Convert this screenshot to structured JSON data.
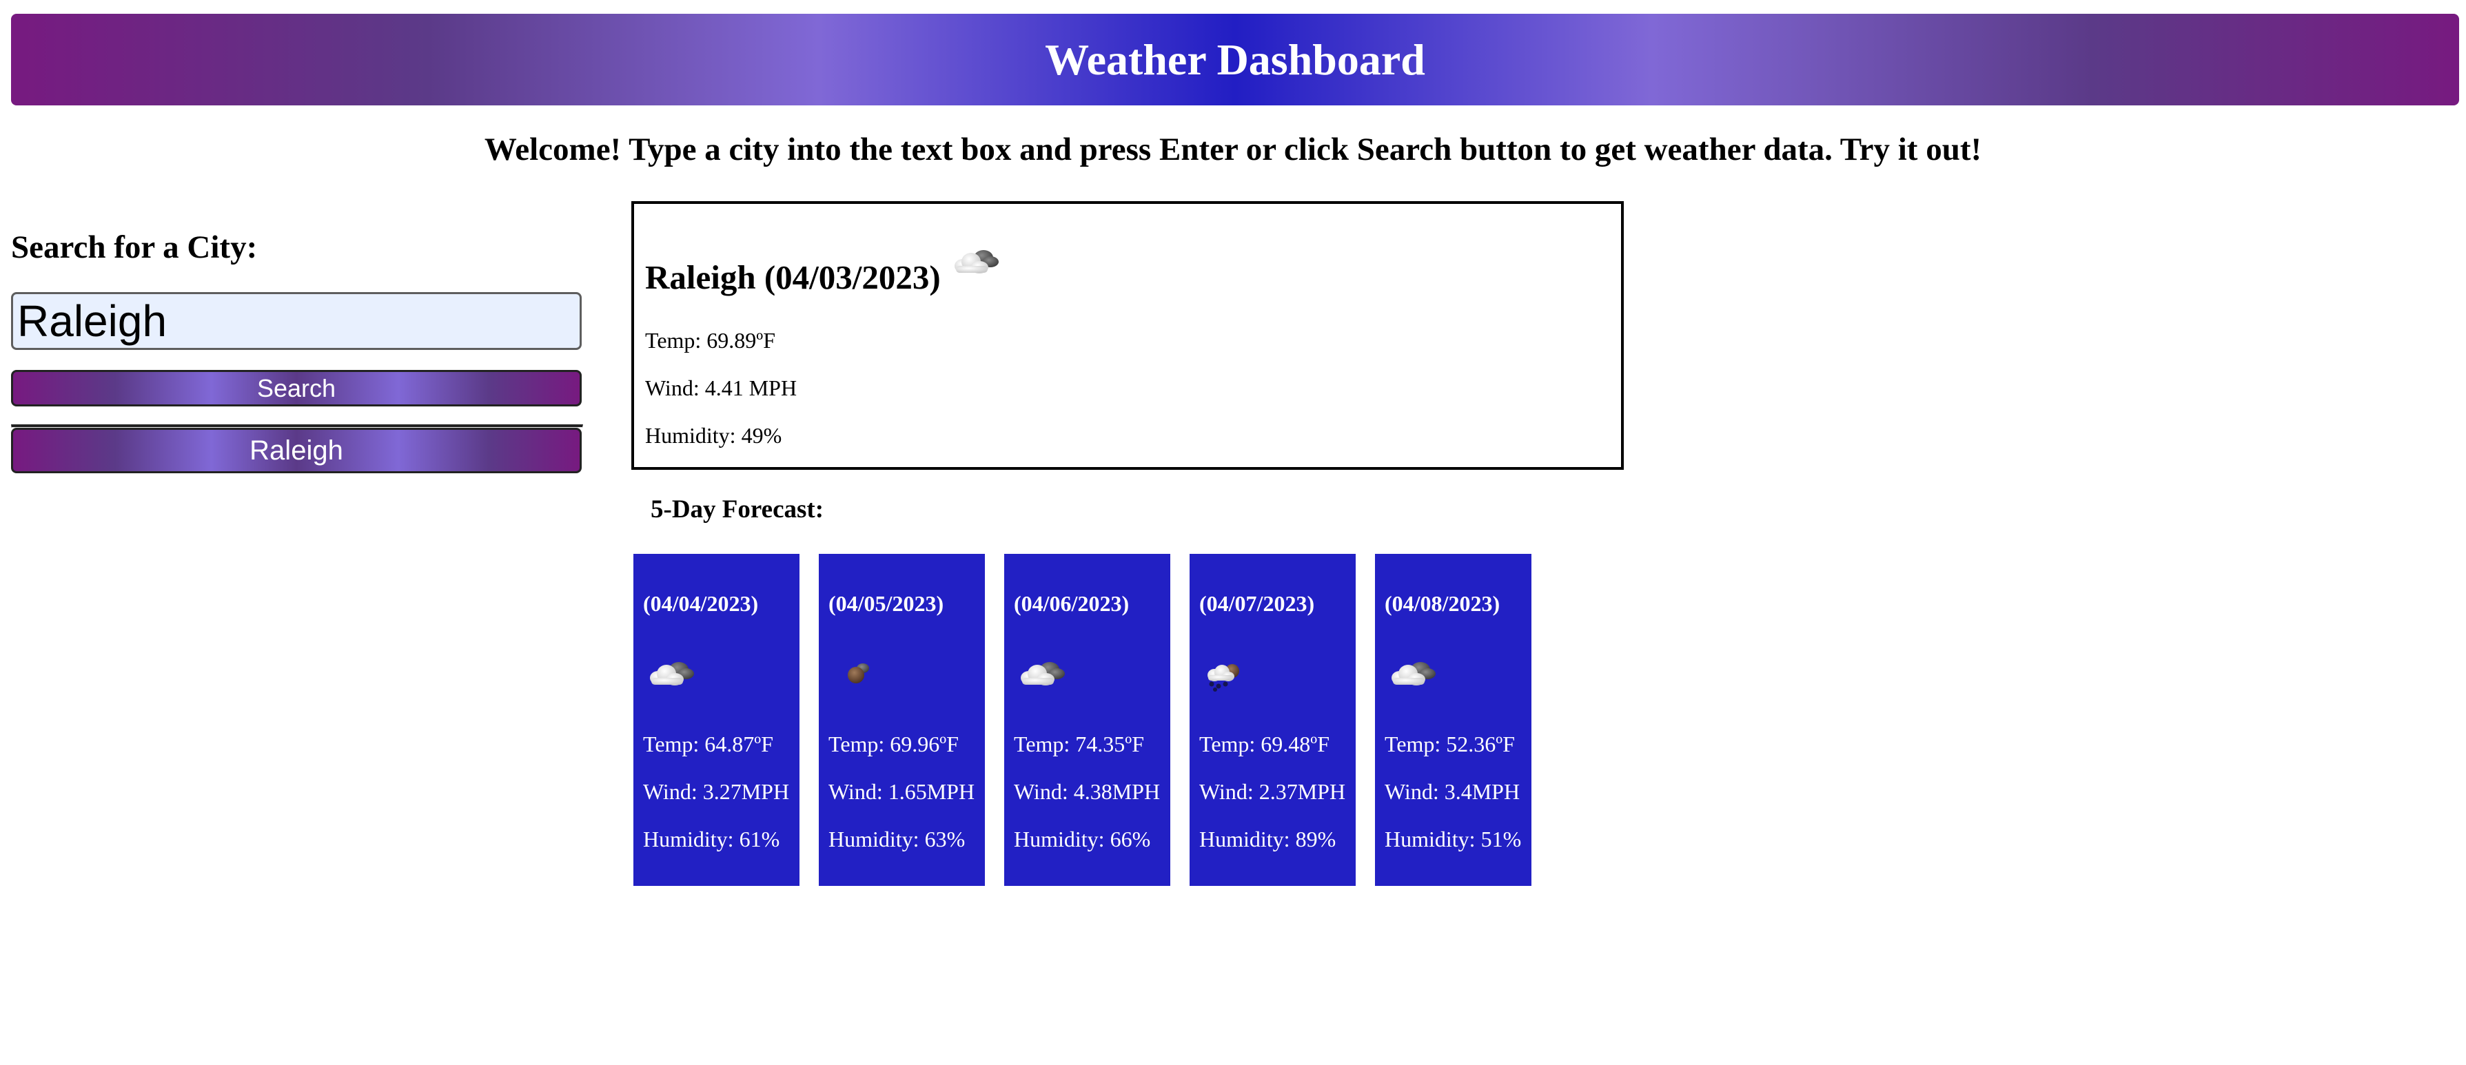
{
  "header": {
    "title": "Weather Dashboard"
  },
  "welcome": "Welcome! Type a city into the text box and press Enter or click Search button to get weather data. Try it out!",
  "search": {
    "heading": "Search for a City:",
    "value": "Raleigh",
    "button_label": "Search"
  },
  "history": [
    "Raleigh"
  ],
  "current": {
    "title": "Raleigh (04/03/2023)",
    "icon": "cloud-icon",
    "temp": "Temp: 69.89ºF",
    "wind": "Wind: 4.41 MPH",
    "humidity": "Humidity: 49%"
  },
  "forecast": {
    "title": "5-Day Forecast:",
    "days": [
      {
        "date": "(04/04/2023)",
        "icon": "cloud-icon",
        "temp": "Temp: 64.87ºF",
        "wind": "Wind: 3.27MPH",
        "humidity": "Humidity: 61%"
      },
      {
        "date": "(04/05/2023)",
        "icon": "storm-icon",
        "temp": "Temp: 69.96ºF",
        "wind": "Wind: 1.65MPH",
        "humidity": "Humidity: 63%"
      },
      {
        "date": "(04/06/2023)",
        "icon": "cloud-icon",
        "temp": "Temp: 74.35ºF",
        "wind": "Wind: 4.38MPH",
        "humidity": "Humidity: 66%"
      },
      {
        "date": "(04/07/2023)",
        "icon": "rain-icon",
        "temp": "Temp: 69.48ºF",
        "wind": "Wind: 2.37MPH",
        "humidity": "Humidity: 89%"
      },
      {
        "date": "(04/08/2023)",
        "icon": "cloud-icon",
        "temp": "Temp: 52.36ºF",
        "wind": "Wind: 3.4MPH",
        "humidity": "Humidity: 51%"
      }
    ]
  },
  "colors": {
    "card_background": "#2220c4",
    "gradient_purple": "#771a80",
    "gradient_lavender": "#8068d6",
    "gradient_blue": "#221ec4"
  }
}
